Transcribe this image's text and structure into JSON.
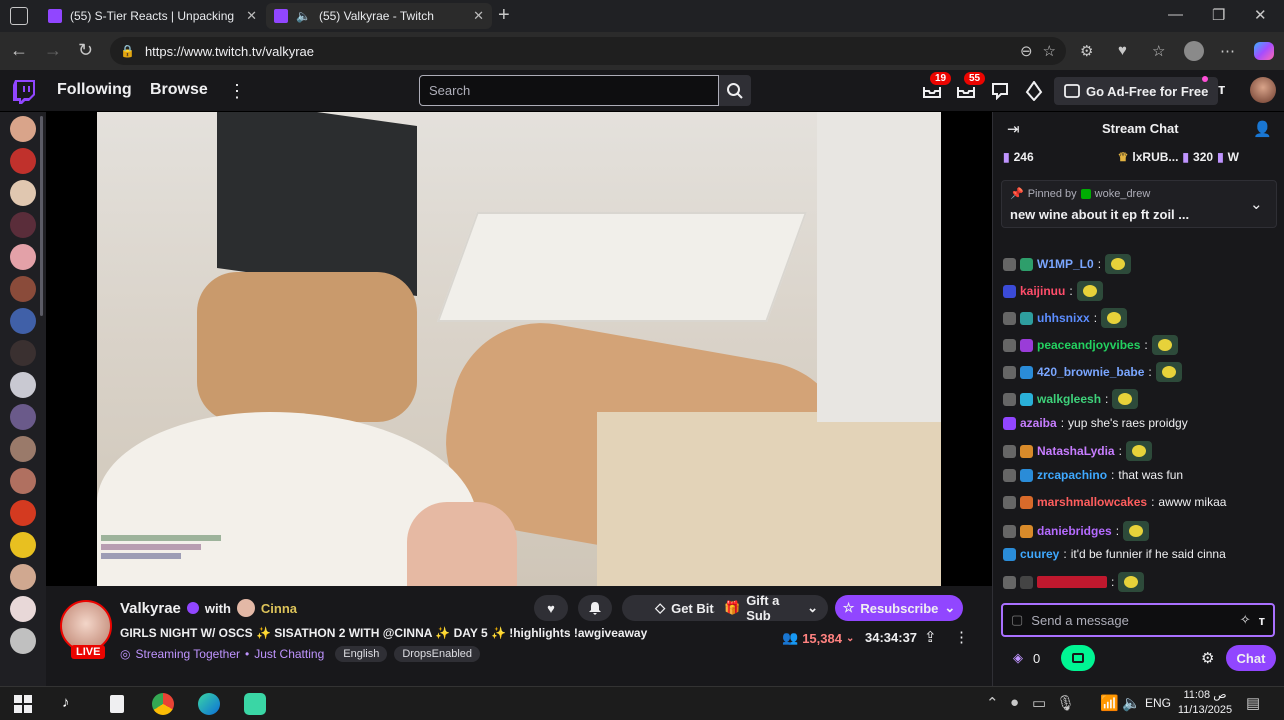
{
  "browser": {
    "tabs": [
      {
        "title": "(55) S-Tier Reacts | Unpacking Dr",
        "active": false
      },
      {
        "title": "(55) Valkyrae - Twitch",
        "active": true
      }
    ],
    "url": "https://www.twitch.tv/valkyrae"
  },
  "twitch_nav": {
    "following": "Following",
    "browse": "Browse",
    "search_placeholder": "Search",
    "inbox_count": "19",
    "notif_count": "55",
    "ad_free_label": "Go Ad-Free for Free"
  },
  "stream": {
    "channel_name": "Valkyrae",
    "with_label": "with",
    "co_streamer": "Cinna",
    "title": "GIRLS NIGHT W/ OSCS ✨ SISATHON 2 WITH @CINNA ✨ DAY 5 ✨ !highlights !awgiveaway",
    "live_label": "LIVE",
    "streaming_together": "Streaming Together",
    "separator": "•",
    "category": "Just Chatting",
    "tags": [
      "English",
      "DropsEnabled"
    ],
    "viewers": "15,384",
    "uptime": "34:34:37",
    "get_bits": "Get Bits",
    "gift_sub": "Gift a Sub",
    "resubscribe": "Resubscribe"
  },
  "chat": {
    "header_title": "Stream Chat",
    "leaderboard": [
      {
        "value": "246"
      },
      {
        "name": "lxRUB...",
        "value": "320"
      },
      {
        "name": "W"
      }
    ],
    "pinned": {
      "label": "Pinned by",
      "by": "woke_drew",
      "text": "new wine about it ep ft zoil ..."
    },
    "messages": [
      {
        "user": "W1MP_L0",
        "color": "#7aa6ff",
        "text": ""
      },
      {
        "user": "kaijinuu",
        "color": "#ff4d6a",
        "text": ""
      },
      {
        "user": "uhhsnixx",
        "color": "#5c8dff",
        "text": ""
      },
      {
        "user": "peaceandjoyvibes",
        "color": "#23d160",
        "text": ""
      },
      {
        "user": "420_brownie_babe",
        "color": "#7aa6ff",
        "text": ""
      },
      {
        "user": "walkgleesh",
        "color": "#3ed17a",
        "text": ""
      },
      {
        "user": "azaiba",
        "color": "#c77dff",
        "text": "yup she's raes proidgy"
      },
      {
        "user": "NatashaLydia",
        "color": "#c77dff",
        "text": ""
      },
      {
        "user": "zrcapachino",
        "color": "#3fa9ff",
        "text": "that was fun"
      },
      {
        "user": "marshmallowcakes",
        "color": "#ff5e5e",
        "text": "awww mikaa"
      },
      {
        "user": "daniebridges",
        "color": "#b56bff",
        "text": ""
      },
      {
        "user": "cuurey",
        "color": "#3fa9ff",
        "text": "it'd be funnier if he said cinna"
      }
    ],
    "input_placeholder": "Send a message",
    "points": "0",
    "chat_button": "Chat"
  },
  "taskbar": {
    "lang": "ENG",
    "time": "11:08 ص",
    "date": "11/13/2025"
  },
  "colors": {
    "twitch_purple": "#9146ff",
    "live_red": "#eb0400"
  }
}
